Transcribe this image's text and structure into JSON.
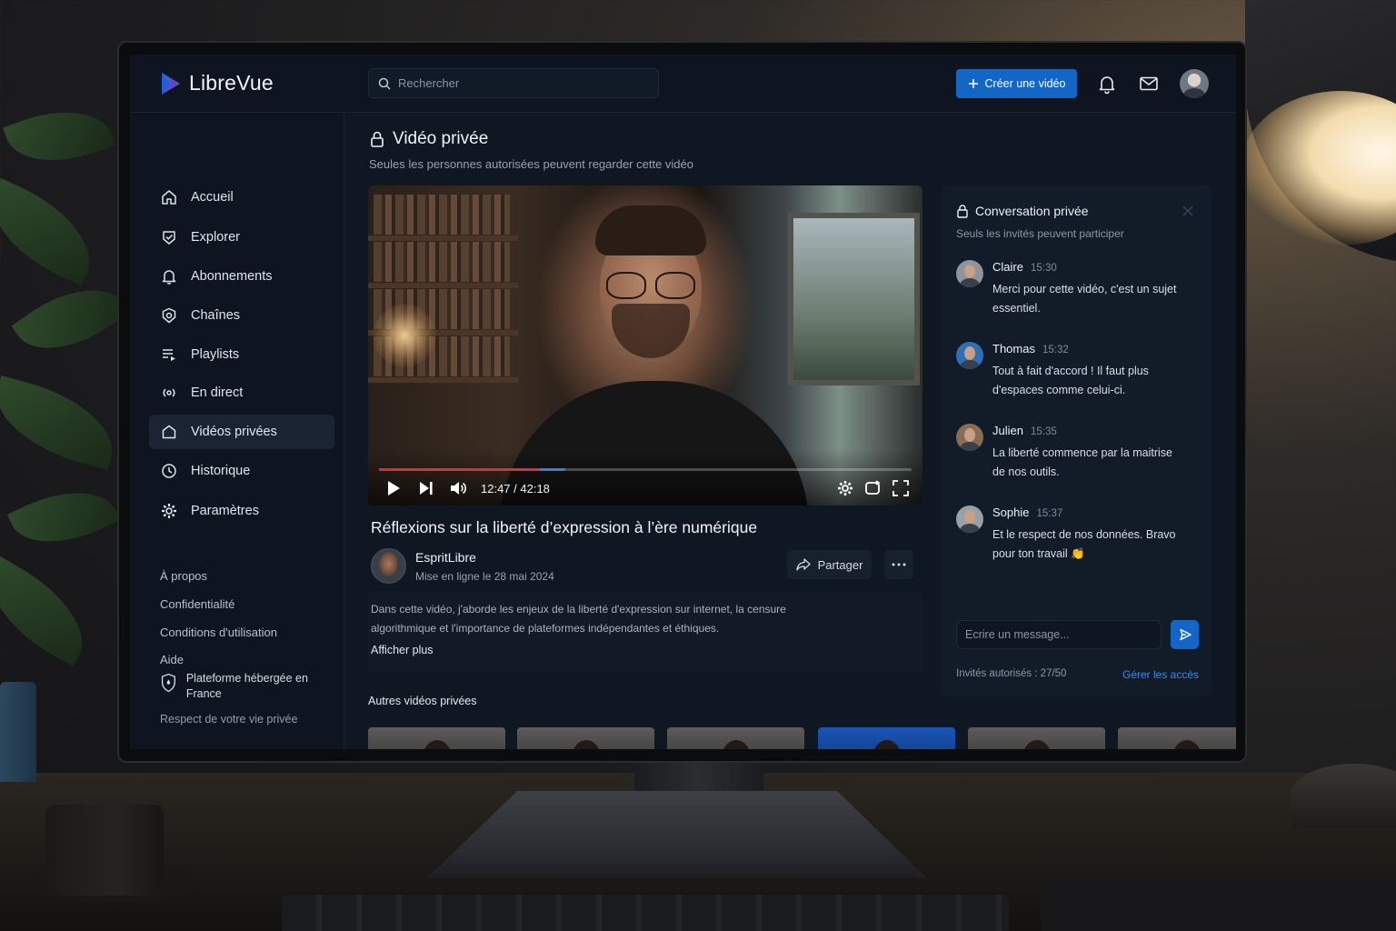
{
  "app": {
    "name": "LibreVue"
  },
  "search": {
    "placeholder": "Rechercher"
  },
  "header": {
    "create_label": "Créer une vidéo"
  },
  "sidebar": {
    "items": [
      {
        "label": "Accueil",
        "icon": "home-icon"
      },
      {
        "label": "Explorer",
        "icon": "compass-icon"
      },
      {
        "label": "Abonnements",
        "icon": "bell-icon"
      },
      {
        "label": "Chaînes",
        "icon": "channel-icon"
      },
      {
        "label": "Playlists",
        "icon": "playlist-icon"
      },
      {
        "label": "En direct",
        "icon": "live-icon"
      },
      {
        "label": "Vidéos privées",
        "icon": "private-icon",
        "active": true
      },
      {
        "label": "Historique",
        "icon": "history-icon"
      },
      {
        "label": "Paramètres",
        "icon": "gear-icon"
      }
    ],
    "links": [
      "À propos",
      "Confidentialité",
      "Conditions d'utilisation",
      "Aide"
    ],
    "hosted": "Plateforme hébergée en France",
    "privacy": "Respect de votre vie privée"
  },
  "page": {
    "title": "Vidéo privée",
    "subtitle": "Seules les personnes autorisées peuvent regarder cette vidéo"
  },
  "player": {
    "time": "12:47 / 42:18",
    "progress_played": 0.302,
    "progress_buffered": 0.35
  },
  "video": {
    "title": "Réflexions sur la liberté d’expression à l’ère numérique",
    "channel": "EspritLibre",
    "date": "Mise en ligne le 28 mai 2024",
    "share_label": "Partager",
    "description": "Dans cette vidéo, j'aborde les enjeux de la liberté d'expression sur internet, la censure algorithmique et l'importance de plateformes indépendantes et éthiques.",
    "show_more": "Afficher plus"
  },
  "others": {
    "title": "Autres vidéos privées"
  },
  "chat": {
    "title": "Conversation privée",
    "subtitle": "Seuls les invités peuvent participer",
    "messages": [
      {
        "author": "Claire",
        "time": "15:30",
        "text": "Merci pour cette vidéo, c'est un sujet essentiel."
      },
      {
        "author": "Thomas",
        "time": "15:32",
        "text": "Tout à fait d'accord ! Il faut plus d'espaces comme celui-ci."
      },
      {
        "author": "Julien",
        "time": "15:35",
        "text": "La liberté commence par la maitrise de nos outils."
      },
      {
        "author": "Sophie",
        "time": "15:37",
        "text": "Et le respect de nos données. Bravo pour ton travail 👏"
      }
    ],
    "input_placeholder": "Ecrire un message...",
    "invited": "Invités autorisés : 27/50",
    "manage": "Gérer les accès"
  },
  "colors": {
    "accent": "#1466c6",
    "progress": "#d6303a",
    "link": "#3d8ce8"
  }
}
